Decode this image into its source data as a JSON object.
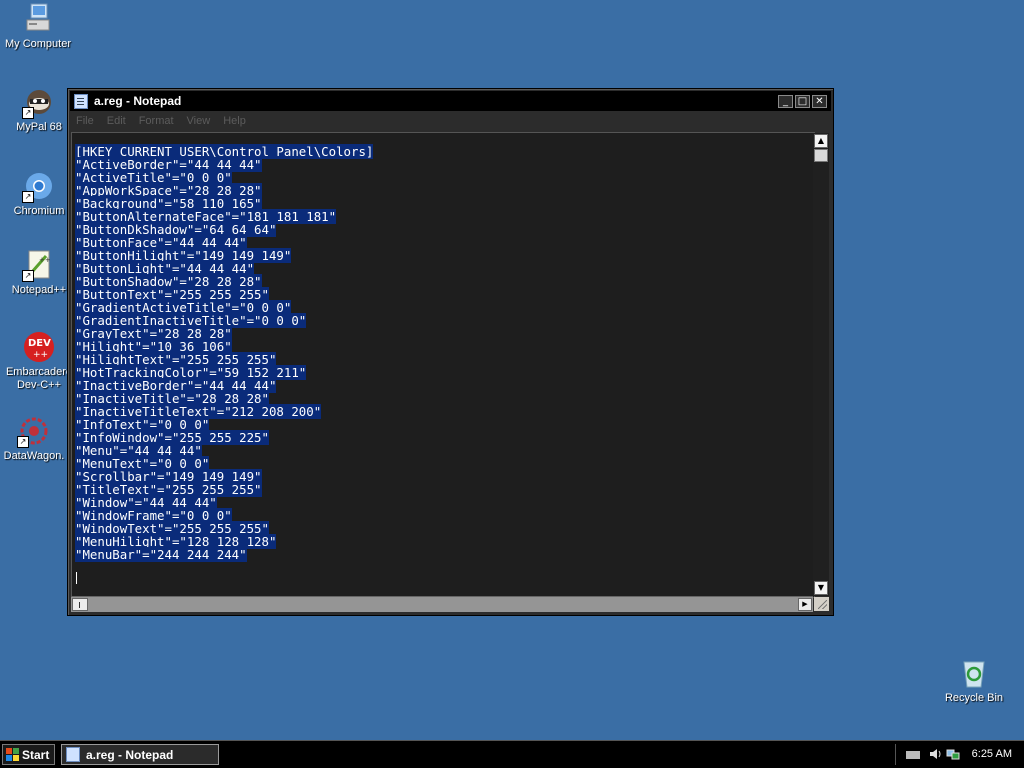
{
  "desktop": {
    "icons": [
      {
        "label": "My Computer"
      },
      {
        "label": "MyPal 68"
      },
      {
        "label": "Chromium"
      },
      {
        "label": "Notepad++"
      },
      {
        "label_line1": "Embarcadero",
        "label_line2": "Dev-C++",
        "badge": "DEV"
      },
      {
        "label": "DataWagon."
      },
      {
        "label": "Recycle Bin"
      }
    ]
  },
  "window": {
    "title": "a.reg - Notepad",
    "buttons": {
      "minimize": "_",
      "maximize": "□",
      "close": "✕"
    },
    "menu": [
      "File",
      "Edit",
      "Format",
      "View",
      "Help"
    ],
    "content_lines": [
      "[HKEY_CURRENT_USER\\Control Panel\\Colors]",
      "\"ActiveBorder\"=\"44 44 44\"",
      "\"ActiveTitle\"=\"0 0 0\"",
      "\"AppWorkSpace\"=\"28 28 28\"",
      "\"Background\"=\"58 110 165\"",
      "\"ButtonAlternateFace\"=\"181 181 181\"",
      "\"ButtonDkShadow\"=\"64 64 64\"",
      "\"ButtonFace\"=\"44 44 44\"",
      "\"ButtonHilight\"=\"149 149 149\"",
      "\"ButtonLight\"=\"44 44 44\"",
      "\"ButtonShadow\"=\"28 28 28\"",
      "\"ButtonText\"=\"255 255 255\"",
      "\"GradientActiveTitle\"=\"0 0 0\"",
      "\"GradientInactiveTitle\"=\"0 0 0\"",
      "\"GrayText\"=\"28 28 28\"",
      "\"Hilight\"=\"10 36 106\"",
      "\"HilightText\"=\"255 255 255\"",
      "\"HotTrackingColor\"=\"59 152 211\"",
      "\"InactiveBorder\"=\"44 44 44\"",
      "\"InactiveTitle\"=\"28 28 28\"",
      "\"InactiveTitleText\"=\"212 208 200\"",
      "\"InfoText\"=\"0 0 0\"",
      "\"InfoWindow\"=\"255 255 225\"",
      "\"Menu\"=\"44 44 44\"",
      "\"MenuText\"=\"0 0 0\"",
      "\"Scrollbar\"=\"149 149 149\"",
      "\"TitleText\"=\"255 255 255\"",
      "\"Window\"=\"44 44 44\"",
      "\"WindowFrame\"=\"0 0 0\"",
      "\"WindowText\"=\"255 255 255\"",
      "\"MenuHilight\"=\"128 128 128\"",
      "\"MenuBar\"=\"244 244 244\""
    ]
  },
  "taskbar": {
    "start_label": "Start",
    "task_label": "a.reg - Notepad",
    "clock": "6:25 AM"
  },
  "colors": {
    "desktop": "#3a6ea5",
    "selection": "#0a2b7a",
    "editor_bg": "#1e1e1e"
  }
}
